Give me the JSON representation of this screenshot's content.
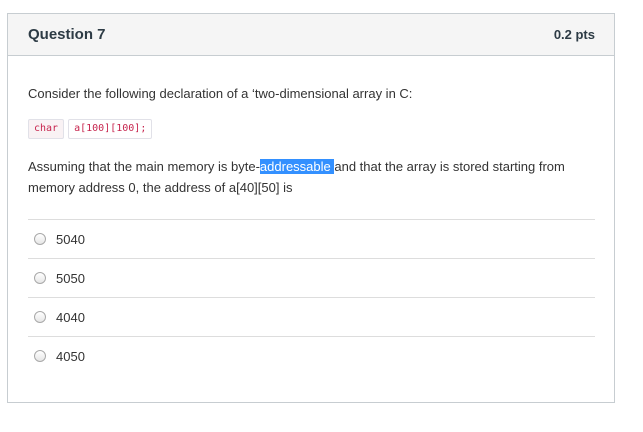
{
  "question": {
    "title": "Question 7",
    "points": "0.2 pts",
    "intro": "Consider the following declaration of a ‘two-dimensional array in C:",
    "code_tokens": [
      "char",
      "a[100][100];"
    ],
    "para_before": "Assuming that the main memory is byte-",
    "para_highlight": "addressable ",
    "para_after": "and that the array is stored starting from memory address 0, the address of a[40][50] is"
  },
  "answers": [
    {
      "label": "5040",
      "selected": false
    },
    {
      "label": "5050",
      "selected": false
    },
    {
      "label": "4040",
      "selected": false
    },
    {
      "label": "4050",
      "selected": false
    }
  ]
}
